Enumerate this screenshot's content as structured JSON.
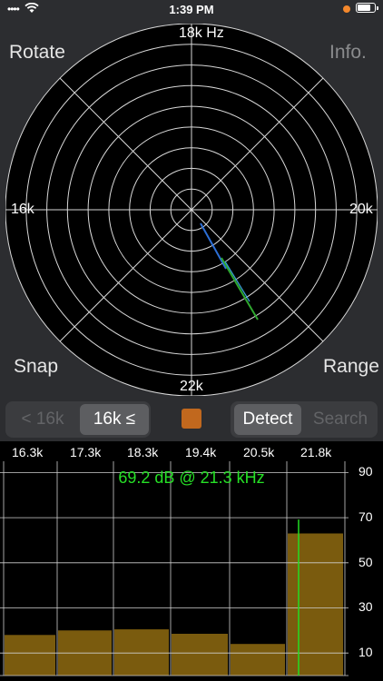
{
  "status_bar": {
    "time": "1:39 PM",
    "carrier": "••••",
    "battery_level": 0.85
  },
  "buttons": {
    "rotate": "Rotate",
    "info": "Info.",
    "snap": "Snap",
    "range": "Range"
  },
  "radar": {
    "top_label": "18k Hz",
    "left_label": "16k",
    "right_label": "20k",
    "bottom_label": "22k",
    "rings": 9,
    "spokes": 8
  },
  "controls": {
    "range_low": "< 16k",
    "range_high": "16k ≤",
    "selected_range": "16k ≤",
    "detect": "Detect",
    "search": "Search",
    "selected_mode": "Detect",
    "swatch_color": "#c1681e"
  },
  "chart_data": {
    "type": "bar",
    "title": "69.2 dB @ 21.3 kHz",
    "x_ticks": [
      "16.3k",
      "17.3k",
      "18.3k",
      "19.4k",
      "20.5k",
      "21.8k"
    ],
    "y_ticks": [
      "90",
      "70",
      "50",
      "30",
      "10"
    ],
    "ylim": [
      0,
      95
    ],
    "values": [
      18,
      20,
      20.5,
      18.5,
      14,
      63
    ],
    "peak_db": 69.2,
    "peak_khz": 21.3,
    "bar_color": "#7a5b0e",
    "peak_line_color": "#22dd22"
  }
}
